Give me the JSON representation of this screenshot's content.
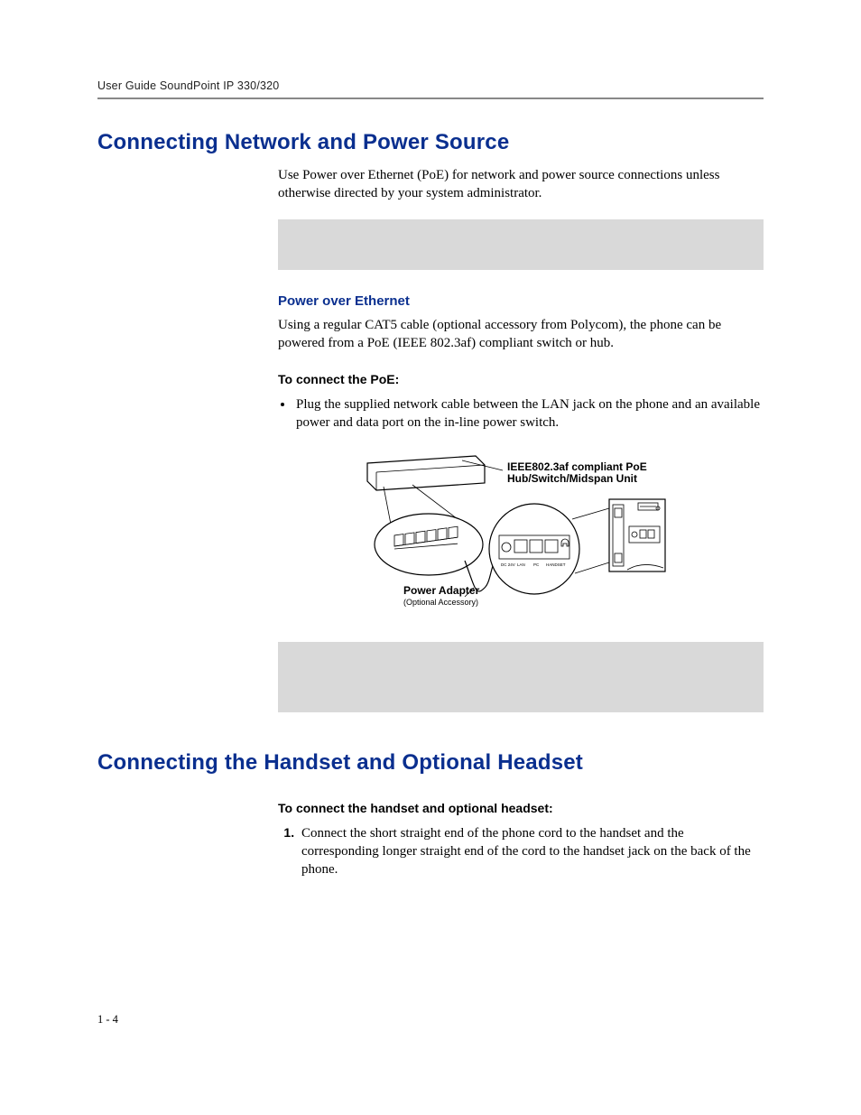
{
  "header": {
    "running_head": "User Guide SoundPoint IP 330/320"
  },
  "section1": {
    "heading": "Connecting Network and Power Source",
    "intro": "Use Power over Ethernet (PoE) for network and power source connections unless otherwise directed by your system administrator.",
    "poe_heading": "Power over Ethernet",
    "poe_para": "Using a regular CAT5 cable (optional accessory from Polycom), the phone can be powered from a PoE (IEEE 802.3af) compliant switch or hub.",
    "connect_heading": "To connect the PoE:",
    "connect_bullet": "Plug the supplied network cable between the LAN jack on the phone and an available power and data port on the in-line power switch."
  },
  "diagram": {
    "poe_line1": "IEEE802.3af compliant PoE",
    "poe_line2": "Hub/Switch/Midspan Unit",
    "pa_line1": "Power Adapter",
    "pa_line2": "(Optional Accessory)",
    "port_dc": "DC 24V",
    "port_lan": "LAN",
    "port_pc": "PC",
    "port_handset": "HANDSET"
  },
  "section2": {
    "heading": "Connecting the Handset and Optional Headset",
    "sub_heading": "To connect the handset and optional headset:",
    "step1": "Connect the short straight end of the phone cord to the handset and the corresponding longer straight end of the cord to the handset jack on the back of the phone."
  },
  "footer": {
    "page": "1 - 4"
  }
}
